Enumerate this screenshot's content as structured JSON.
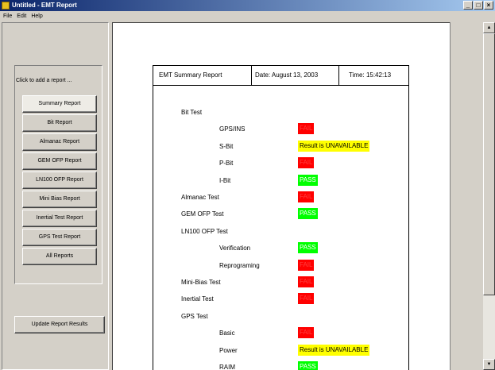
{
  "window": {
    "title": "Untitled - EMT Report",
    "controls": [
      "_",
      "□",
      "×"
    ]
  },
  "menu": [
    "File",
    "Edit",
    "Help"
  ],
  "left": {
    "prompt": "Click to add a report ...",
    "buttons": [
      "Summary Report",
      "Bit Report",
      "Almanac Report",
      "GEM OFP Report",
      "LN100 OFP Report",
      "Mini Bias Report",
      "Inertial Test Report",
      "GPS Test Report",
      "All Reports"
    ],
    "selected": "Summary Report",
    "update_button": "Update Report Results"
  },
  "report": {
    "header_title": "EMT Summary Report",
    "date_label": "Date:",
    "date_value": "August 13, 2003",
    "time_label": "Time:",
    "time_value": "15:42:13",
    "rows": [
      {
        "label": "Bit Test",
        "level": 0,
        "status": null
      },
      {
        "label": "GPS/INS",
        "level": 1,
        "status": "FAIL",
        "kind": "fail"
      },
      {
        "label": "S-Bit",
        "level": 1,
        "status": "Result is UNAVAILABLE",
        "kind": "unavail"
      },
      {
        "label": "P-Bit",
        "level": 1,
        "status": "FAIL",
        "kind": "fail"
      },
      {
        "label": "I-Bit",
        "level": 1,
        "status": "PASS",
        "kind": "pass"
      },
      {
        "label": "Almanac Test",
        "level": 0,
        "status": "FAIL",
        "kind": "fail"
      },
      {
        "label": "GEM OFP Test",
        "level": 0,
        "status": "PASS",
        "kind": "pass"
      },
      {
        "label": "LN100 OFP Test",
        "level": 0,
        "status": null
      },
      {
        "label": "Verification",
        "level": 1,
        "status": "PASS",
        "kind": "pass"
      },
      {
        "label": "Reprograming",
        "level": 1,
        "status": "FAIL",
        "kind": "fail"
      },
      {
        "label": "Mini-Bias Test",
        "level": 0,
        "status": "FAIL",
        "kind": "fail"
      },
      {
        "label": "Inertial Test",
        "level": 0,
        "status": "FAIL",
        "kind": "fail"
      },
      {
        "label": "GPS Test",
        "level": 0,
        "status": null
      },
      {
        "label": "Basic",
        "level": 1,
        "status": "FAIL",
        "kind": "fail"
      },
      {
        "label": "Power",
        "level": 1,
        "status": "Result is UNAVAILABLE",
        "kind": "unavail"
      },
      {
        "label": "RAIM",
        "level": 1,
        "status": "PASS",
        "kind": "pass"
      }
    ]
  },
  "colors": {
    "fail": "#ff0000",
    "pass": "#00ff00",
    "unavailable": "#ffff00",
    "titlebar": "#0a246a"
  }
}
